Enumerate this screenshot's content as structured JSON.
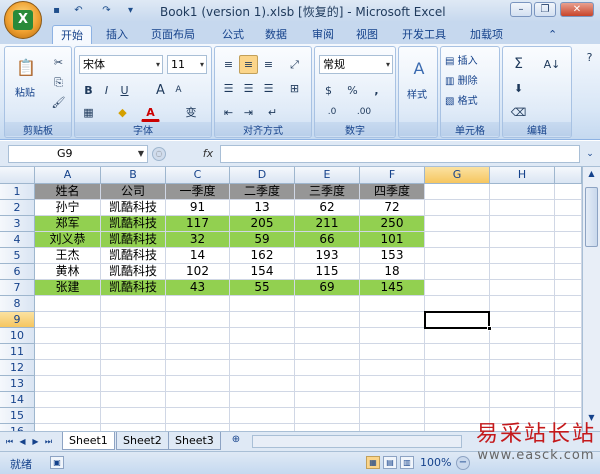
{
  "window": {
    "title": "Book1 (version 1).xlsb [恢复的] - Microsoft Excel",
    "minimize": "–",
    "restore": "❐",
    "close": "✕"
  },
  "office_button": {
    "glyph": "X"
  },
  "qat": {
    "save": "▪",
    "undo": "↶",
    "redo": "↷",
    "customize": "▾"
  },
  "tabs": [
    "开始",
    "插入",
    "页面布局",
    "公式",
    "数据",
    "审阅",
    "视图",
    "开发工具",
    "加载项"
  ],
  "active_tab": "开始",
  "ribbon": {
    "clipboard": {
      "label": "剪贴板",
      "paste": "粘贴"
    },
    "font": {
      "label": "字体",
      "font_name": "宋体",
      "font_size": "11",
      "bold": "B",
      "italic": "I",
      "underline": "U",
      "grow": "A",
      "shrink": "A",
      "phonetic": "变"
    },
    "alignment": {
      "label": "对齐方式"
    },
    "number": {
      "label": "数字",
      "format": "常规",
      "currency": "$",
      "percent": "%",
      "comma": ",",
      "inc_decimal": ".0",
      "dec_decimal": ".00"
    },
    "styles": {
      "label": "样式"
    },
    "cells": {
      "label": "单元格",
      "insert": "插入",
      "delete": "删除",
      "format": "格式"
    },
    "editing": {
      "label": "编辑",
      "sum": "Σ",
      "sort": "A↓"
    }
  },
  "formula_bar": {
    "name_box": "G9",
    "fx": "fx",
    "formula": ""
  },
  "columns": [
    "A",
    "B",
    "C",
    "D",
    "E",
    "F",
    "G",
    "H"
  ],
  "selected_column": "G",
  "selected_row": "9",
  "row_numbers": [
    "1",
    "2",
    "3",
    "4",
    "5",
    "6",
    "7",
    "8",
    "9",
    "10",
    "11",
    "12",
    "13",
    "14",
    "15",
    "16"
  ],
  "sheet": {
    "headers": [
      "姓名",
      "公司",
      "一季度",
      "二季度",
      "三季度",
      "四季度"
    ],
    "rows": [
      [
        "孙宁",
        "凯酷科技",
        "91",
        "13",
        "62",
        "72"
      ],
      [
        "郑军",
        "凯酷科技",
        "117",
        "205",
        "211",
        "250"
      ],
      [
        "刘义恭",
        "凯酷科技",
        "32",
        "59",
        "66",
        "101"
      ],
      [
        "王杰",
        "凯酷科技",
        "14",
        "162",
        "193",
        "153"
      ],
      [
        "黄林",
        "凯酷科技",
        "102",
        "154",
        "115",
        "18"
      ],
      [
        "张建",
        "凯酷科技",
        "43",
        "55",
        "69",
        "145"
      ]
    ],
    "highlighted_rows": [
      1,
      2,
      5
    ]
  },
  "colors": {
    "header_fill": "#969696",
    "highlight_fill": "#92d050",
    "selection": "#000000"
  },
  "sheet_tabs": [
    "Sheet1",
    "Sheet2",
    "Sheet3"
  ],
  "active_sheet": "Sheet1",
  "status": {
    "ready": "就绪",
    "zoom": "100%"
  },
  "watermark": {
    "title": "易采站长站",
    "url": "www.easck.com"
  }
}
